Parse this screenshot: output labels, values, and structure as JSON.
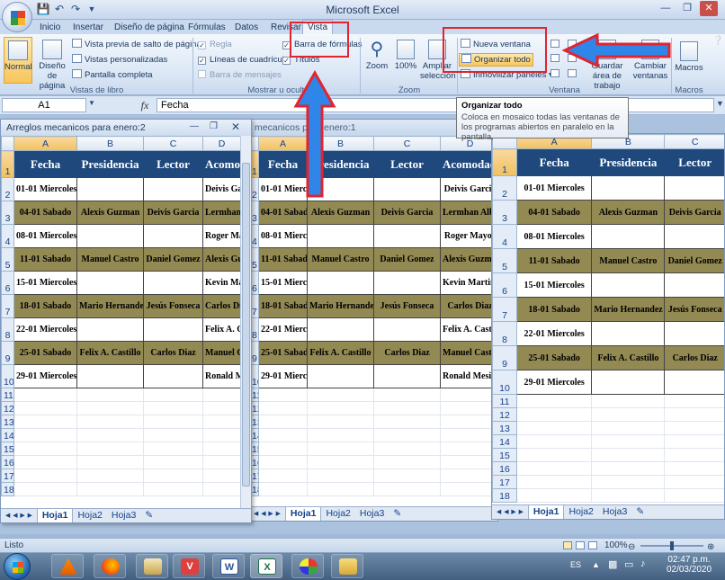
{
  "app": {
    "title": "Microsoft Excel",
    "quick_access": [
      "save-icon",
      "undo-icon",
      "redo-icon",
      "customize-icon"
    ],
    "window_controls": [
      "minimize-icon",
      "restore-icon",
      "close-icon"
    ]
  },
  "ribbon": {
    "tabs": [
      "Inicio",
      "Insertar",
      "Diseño de página",
      "Fórmulas",
      "Datos",
      "Revisar",
      "Vista"
    ],
    "active_tab": "Vista",
    "groups": {
      "vistas_libro": {
        "label": "Vistas de libro",
        "normal": "Normal",
        "diseno": "Diseño de página",
        "vista_previa": "Vista previa de salto de página",
        "personalizadas": "Vistas personalizadas",
        "pantalla": "Pantalla completa"
      },
      "mostrar": {
        "label": "Mostrar u ocultar",
        "regla": "Regla",
        "lineas": "Líneas de cuadrícula",
        "mensajes": "Barra de mensajes",
        "barra_formulas": "Barra de fórmulas",
        "titulos": "Títulos"
      },
      "zoom": {
        "label": "Zoom",
        "zoom": "Zoom",
        "cien": "100%",
        "ampliar": "Ampliar selección"
      },
      "ventana": {
        "label": "Ventana",
        "nueva": "Nueva ventana",
        "organizar": "Organizar todo",
        "inmovilizar": "Inmovilizar paneles",
        "guardar": "Guardar área de trabajo",
        "cambiar": "Cambiar ventanas"
      },
      "macros": {
        "label": "Macros",
        "macros": "Macros"
      }
    }
  },
  "formula_bar": {
    "name_box": "A1",
    "fx": "fx",
    "content": "Fecha"
  },
  "tooltip": {
    "title": "Organizar todo",
    "body": "Coloca en mosaico todas las ventanas de los programas abiertos en paralelo en la pantalla."
  },
  "windows": {
    "left_title": "Arreglos mecanicos para enero:2",
    "middle_title": "mecanicos para enero:1"
  },
  "sheet": {
    "columns": [
      "A",
      "B",
      "C",
      "D"
    ],
    "headers": [
      "Fecha",
      "Presidencia",
      "Lector",
      "Acomodador"
    ],
    "rows": [
      [
        "01-01 Miercoles",
        "",
        "",
        "Deivis Garcia"
      ],
      [
        "04-01 Sabado",
        "Alexis Guzman",
        "Deivis Garcia",
        "Lermhan Alborn"
      ],
      [
        "08-01 Miercoles",
        "",
        "",
        "Roger Mayor"
      ],
      [
        "11-01 Sabado",
        "Manuel Castro",
        "Daniel Gomez",
        "Alexis Guzman"
      ],
      [
        "15-01 Miercoles",
        "",
        "",
        "Kevin Martinez"
      ],
      [
        "18-01 Sabado",
        "Mario Hernandez",
        "Jesús Fonseca",
        "Carlos Diaz"
      ],
      [
        "22-01 Miercoles",
        "",
        "",
        "Felix A. Castillo"
      ],
      [
        "25-01 Sabado",
        "Felix A. Castillo",
        "Carlos Diaz",
        "Manuel Castro"
      ],
      [
        "29-01 Miercoles",
        "",
        "",
        "Ronald Mesino"
      ]
    ],
    "right_rows": [
      [
        "01-01 Miercoles",
        "",
        ""
      ],
      [
        "04-01 Sabado",
        "Alexis Guzman",
        "Deivis Garcia"
      ],
      [
        "08-01 Miercoles",
        "",
        ""
      ],
      [
        "11-01 Sabado",
        "Manuel Castro",
        "Daniel Gomez"
      ],
      [
        "15-01 Miercoles",
        "",
        ""
      ],
      [
        "18-01 Sabado",
        "Mario Hernandez",
        "Jesús Fonseca"
      ],
      [
        "22-01 Miercoles",
        "",
        ""
      ],
      [
        "25-01 Sabado",
        "Felix A. Castillo",
        "Carlos Diaz"
      ],
      [
        "29-01 Miercoles",
        "",
        ""
      ]
    ],
    "sheet_tabs": [
      "Hoja1",
      "Hoja2",
      "Hoja3"
    ],
    "header_color": "#1f497d",
    "band_color": "#938953"
  },
  "status": {
    "ready": "Listo",
    "zoom": "100%"
  },
  "taskbar": {
    "apps": [
      "vlc-icon",
      "firefox-icon",
      "archive-icon",
      "vivaldi-icon",
      "word-icon",
      "excel-icon",
      "paint-icon",
      "folder-icon"
    ],
    "lang": "ES",
    "time": "02:47 p.m.",
    "date": "02/03/2020"
  },
  "annotation_color": "#e1242f",
  "arrow_color": "#2f86e8"
}
